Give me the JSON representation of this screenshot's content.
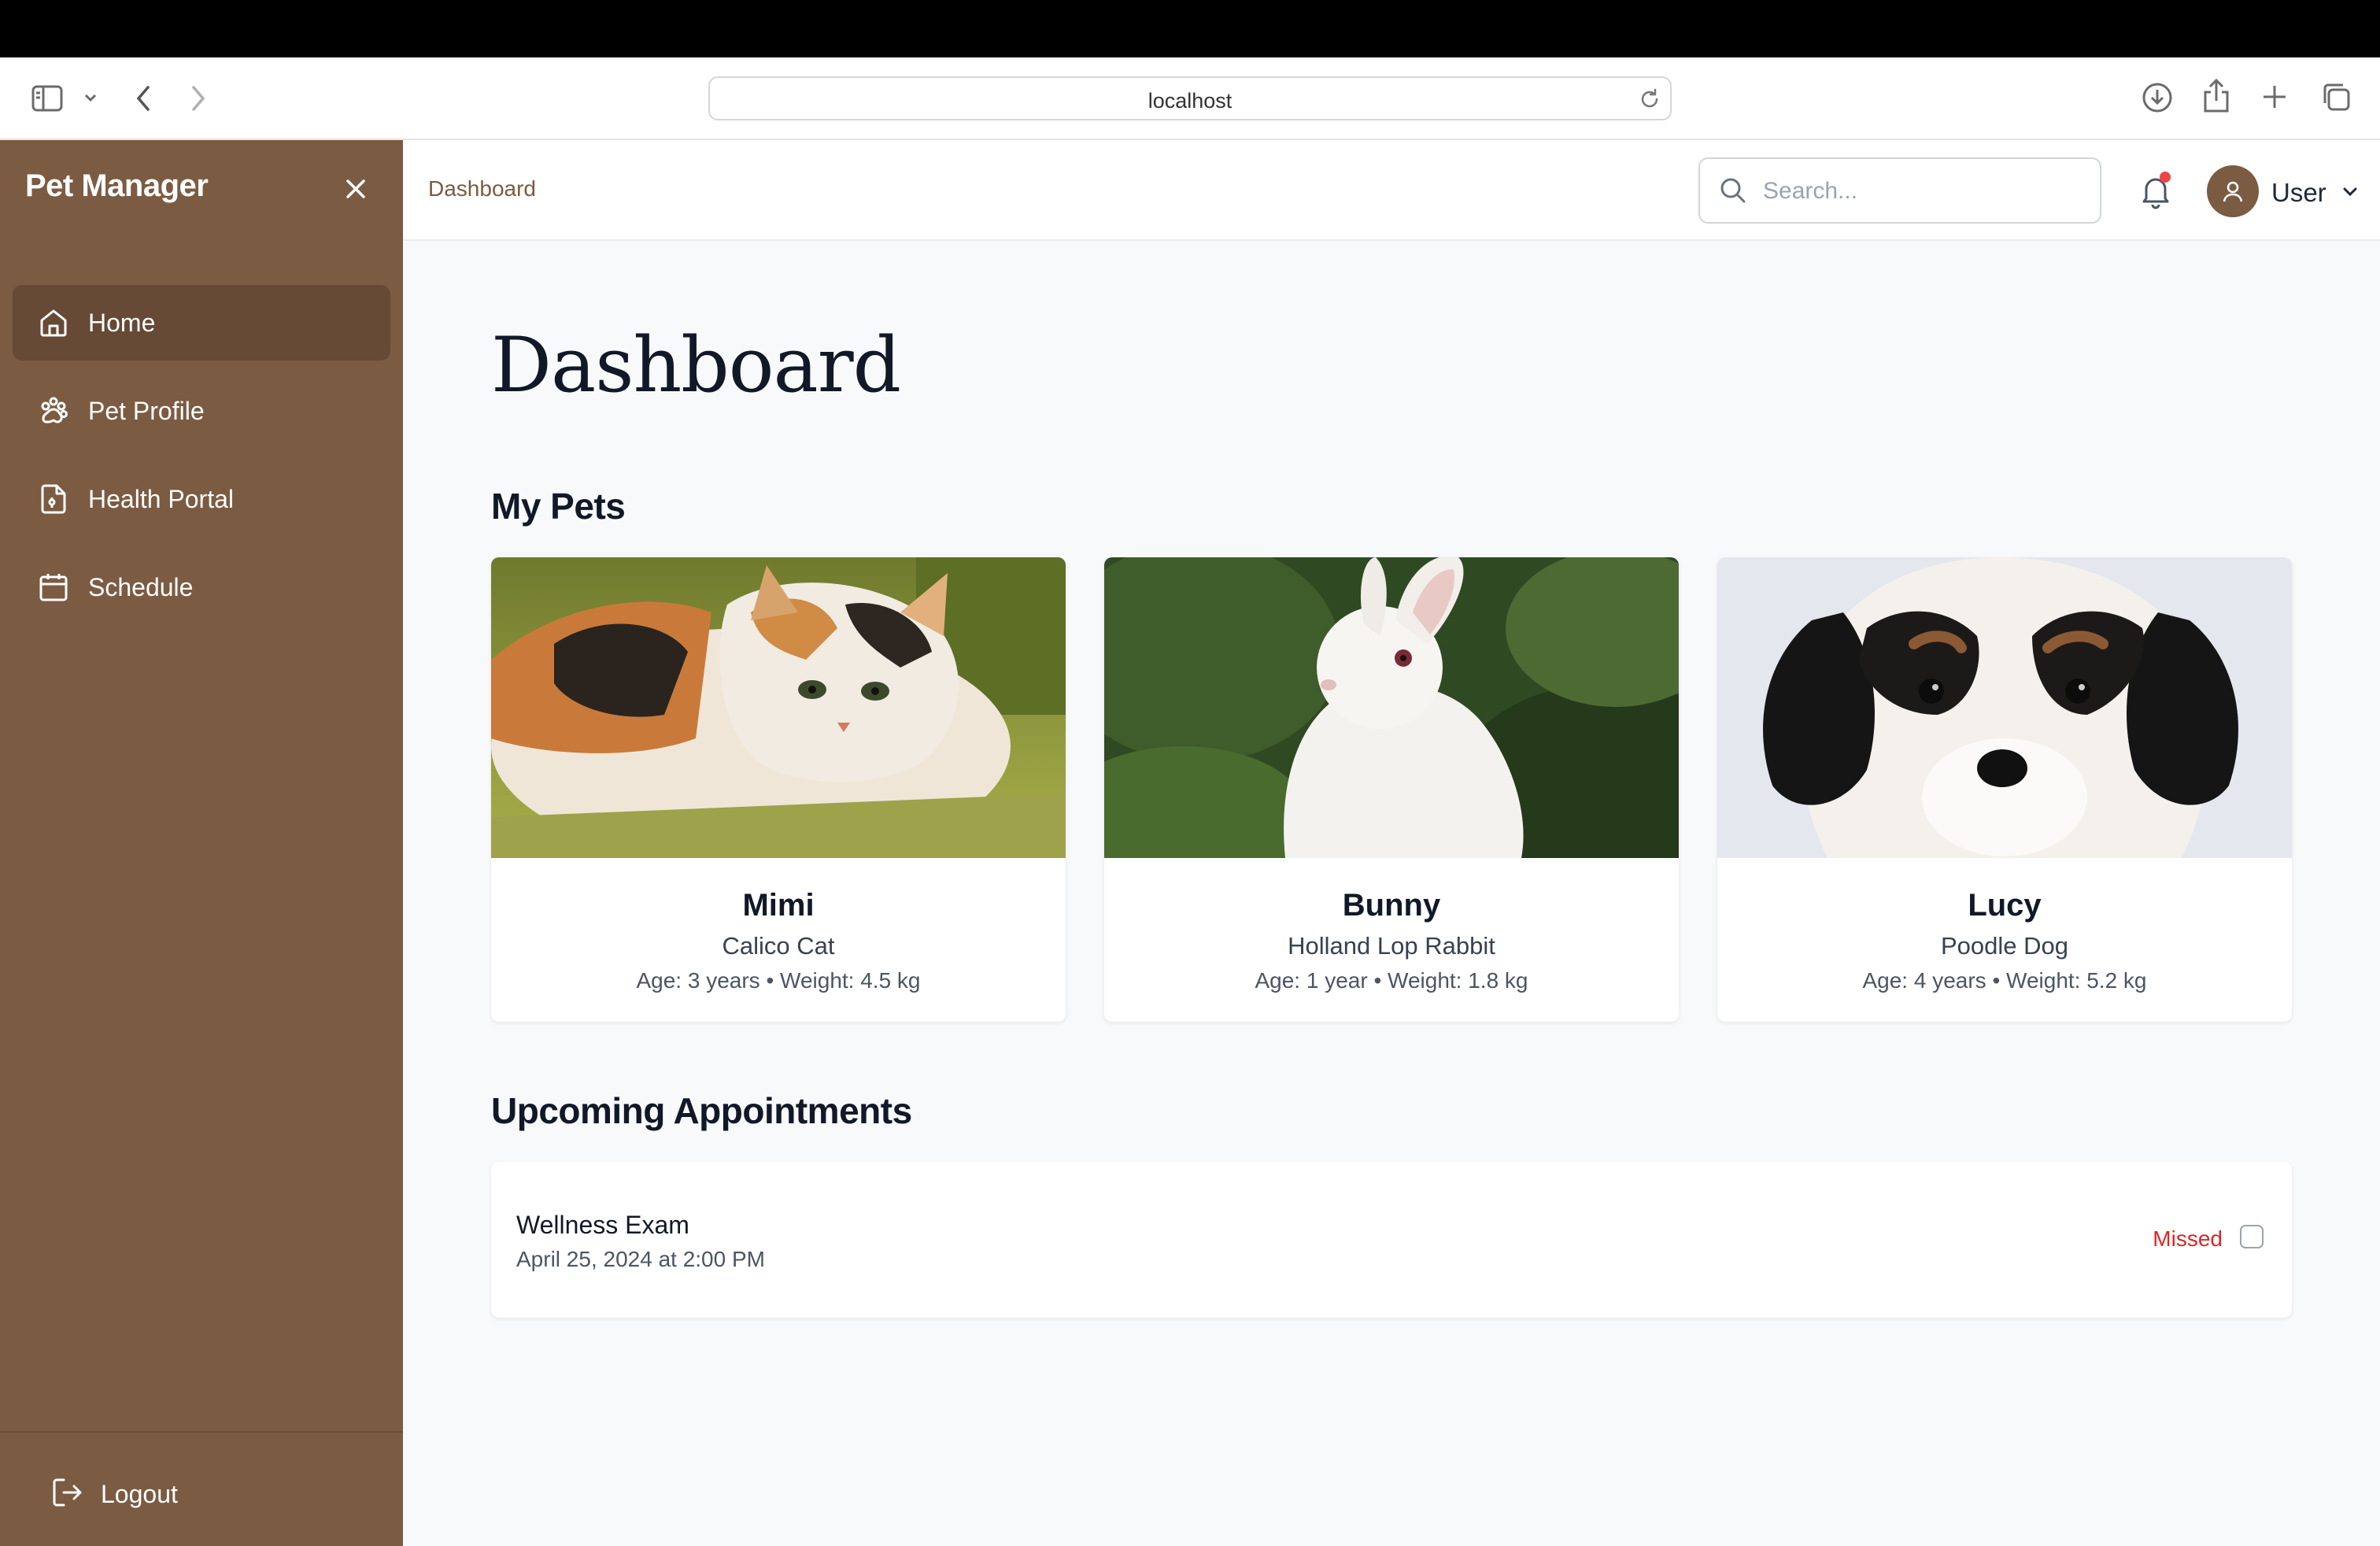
{
  "browser": {
    "url": "localhost"
  },
  "sidebar": {
    "brand": "Pet Manager",
    "items": [
      {
        "label": "Home",
        "icon": "home-icon",
        "active": true
      },
      {
        "label": "Pet Profile",
        "icon": "paw-icon",
        "active": false
      },
      {
        "label": "Health Portal",
        "icon": "medical-file-icon",
        "active": false
      },
      {
        "label": "Schedule",
        "icon": "calendar-icon",
        "active": false
      }
    ],
    "logout_label": "Logout"
  },
  "header": {
    "breadcrumb": "Dashboard",
    "search_placeholder": "Search...",
    "notification_dot": true,
    "user_label": "User"
  },
  "main": {
    "title": "Dashboard",
    "pets_heading": "My Pets",
    "pets": [
      {
        "name": "Mimi",
        "breed": "Calico Cat",
        "stats": "Age: 3 years • Weight: 4.5 kg"
      },
      {
        "name": "Bunny",
        "breed": "Holland Lop Rabbit",
        "stats": "Age: 1 year • Weight: 1.8 kg"
      },
      {
        "name": "Lucy",
        "breed": "Poodle Dog",
        "stats": "Age: 4 years • Weight: 5.2 kg"
      }
    ],
    "appointments_heading": "Upcoming Appointments",
    "appointments": [
      {
        "title": "Wellness Exam",
        "datetime": "April 25, 2024 at 2:00 PM",
        "status": "Missed",
        "checked": false
      }
    ]
  },
  "colors": {
    "sidebar_bg": "#7b5b42",
    "sidebar_active": "#664a36",
    "accent": "#7b5b42",
    "status_missed": "#dc2626",
    "notification": "#ef4444"
  }
}
